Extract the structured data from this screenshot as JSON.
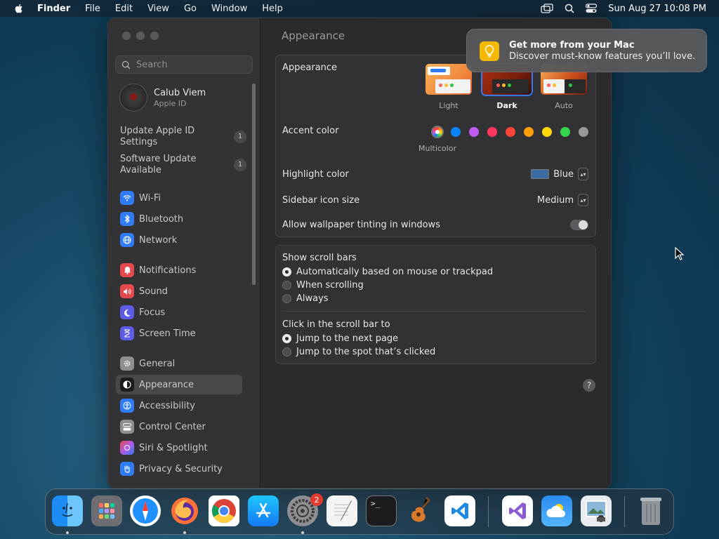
{
  "menubar": {
    "app_name": "Finder",
    "items": [
      "File",
      "Edit",
      "View",
      "Go",
      "Window",
      "Help"
    ],
    "datetime": "Sun Aug 27  10:08 PM",
    "icons": [
      "screen-mirroring-icon",
      "search-icon",
      "control-center-icon"
    ]
  },
  "sidebar": {
    "search_placeholder": "Search",
    "profile": {
      "name": "Calub Viem",
      "subtitle": "Apple ID"
    },
    "updates": [
      {
        "label": "Update Apple ID Settings",
        "line1": "Update Apple ID",
        "line2": "Settings",
        "count": "1"
      },
      {
        "label": "Software Update Available",
        "line1": "Software Update",
        "line2": "Available",
        "count": "1"
      }
    ],
    "items": [
      {
        "label": "Wi-Fi",
        "icon": "wifi-icon",
        "color": "#2f7cf6"
      },
      {
        "label": "Bluetooth",
        "icon": "bluetooth-icon",
        "color": "#2f7cf6"
      },
      {
        "label": "Network",
        "icon": "network-icon",
        "color": "#2f7cf6"
      },
      {
        "label": "Notifications",
        "icon": "notifications-icon",
        "color": "#e5484d"
      },
      {
        "label": "Sound",
        "icon": "sound-icon",
        "color": "#e5484d"
      },
      {
        "label": "Focus",
        "icon": "focus-icon",
        "color": "#5d5ce6"
      },
      {
        "label": "Screen Time",
        "icon": "screen-time-icon",
        "color": "#5d5ce6"
      },
      {
        "label": "General",
        "icon": "gear-icon",
        "color": "#8e8e93"
      },
      {
        "label": "Appearance",
        "icon": "appearance-icon",
        "color": "#1c1c1e"
      },
      {
        "label": "Accessibility",
        "icon": "accessibility-icon",
        "color": "#2f7cf6"
      },
      {
        "label": "Control Center",
        "icon": "control-center-icon",
        "color": "#8e8e93"
      },
      {
        "label": "Siri & Spotlight",
        "icon": "siri-icon",
        "color": "#b05ce6"
      },
      {
        "label": "Privacy & Security",
        "icon": "hand-icon",
        "color": "#2f7cf6"
      }
    ],
    "active": "Appearance"
  },
  "main": {
    "title": "Appearance",
    "appearance": {
      "label": "Appearance",
      "options": [
        "Light",
        "Dark",
        "Auto"
      ],
      "selected": "Dark"
    },
    "accent": {
      "label": "Accent color",
      "selected_caption": "Multicolor",
      "colors": [
        "multicolor",
        "#0a84ff",
        "#bf5af2",
        "#ff375f",
        "#ff453a",
        "#ff9f0a",
        "#ffd60a",
        "#32d74b",
        "#98989d"
      ]
    },
    "highlight": {
      "label": "Highlight color",
      "value": "Blue",
      "swatch": "#3a6ea5"
    },
    "icon_size": {
      "label": "Sidebar icon size",
      "value": "Medium"
    },
    "tinting": {
      "label": "Allow wallpaper tinting in windows",
      "enabled": true
    },
    "scroll_bars": {
      "label": "Show scroll bars",
      "options": [
        "Automatically based on mouse or trackpad",
        "When scrolling",
        "Always"
      ],
      "selected": 0
    },
    "click_scroll": {
      "label": "Click in the scroll bar to",
      "options": [
        "Jump to the next page",
        "Jump to the spot that’s clicked"
      ],
      "selected": 0
    },
    "help": "?"
  },
  "notification": {
    "title": "Get more from your Mac",
    "body": "Discover must-know features you’ll love.",
    "icon": "lightbulb-icon"
  },
  "dock": {
    "apps": [
      "Finder",
      "Launchpad",
      "Safari",
      "Firefox",
      "Chrome",
      "App Store",
      "System Settings",
      "TextEdit",
      "Terminal",
      "GarageBand",
      "Visual Studio Code",
      "Visual Studio",
      "Weather",
      "Preview",
      "Trash"
    ],
    "badges": {
      "System Settings": "2"
    },
    "terminal_prompt": ">_"
  }
}
